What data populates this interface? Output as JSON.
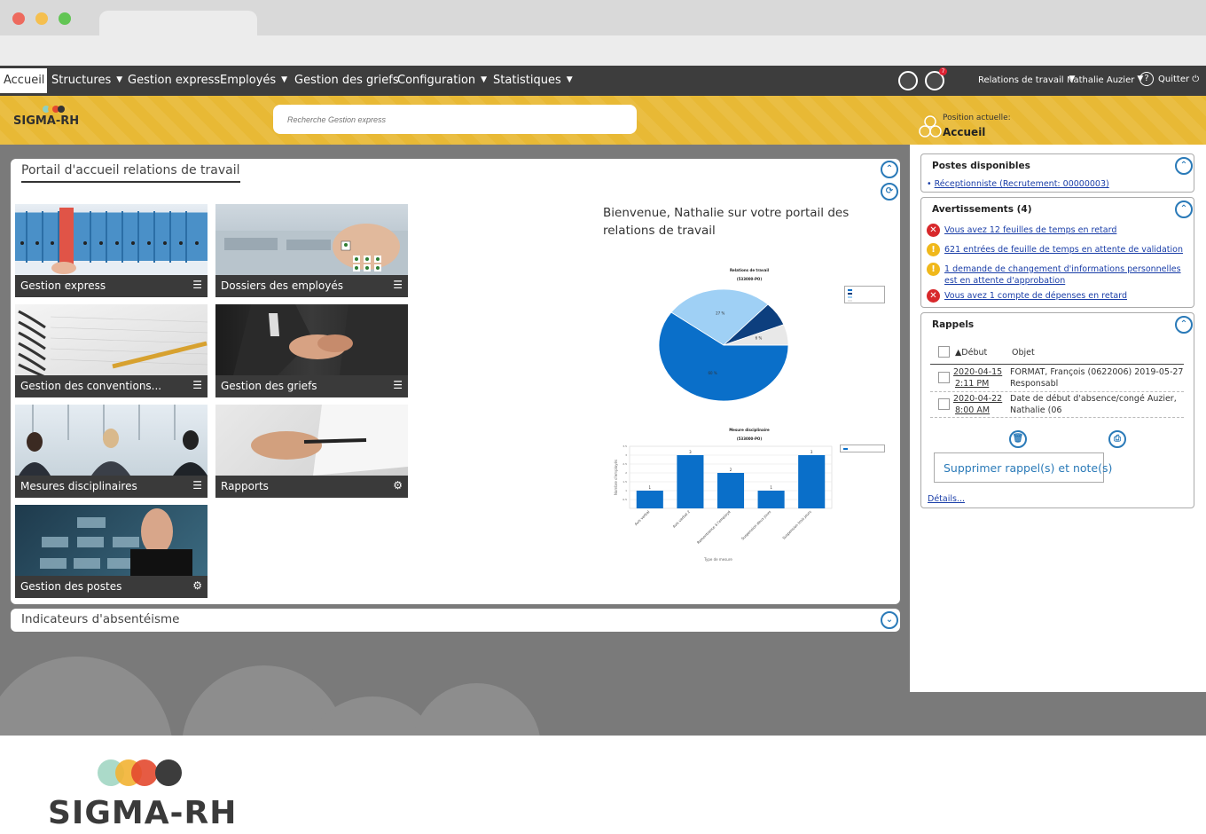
{
  "nav": {
    "items": [
      "Accueil",
      "Structures",
      "Gestion express",
      "Employés",
      "Gestion des griefs",
      "Configuration",
      "Statistiques"
    ],
    "notification_count": "7",
    "right_role": "Relations de travail",
    "right_user": "Nathalie Auzier",
    "help": "?",
    "quit": "Quitter"
  },
  "header": {
    "logo_text": "SIGMA-RH",
    "search_placeholder": "Recherche Gestion express",
    "position_label": "Position actuelle:",
    "position_value": "Accueil"
  },
  "portal": {
    "title": "Portail d'accueil relations de travail",
    "tiles": [
      {
        "label": "Gestion express",
        "icon": "list-icon"
      },
      {
        "label": "Dossiers des employés",
        "icon": "list-icon"
      },
      {
        "label": "Gestion des conventions...",
        "icon": "list-icon"
      },
      {
        "label": "Gestion des griefs",
        "icon": "list-icon"
      },
      {
        "label": "Mesures disciplinaires",
        "icon": "list-icon"
      },
      {
        "label": "Rapports",
        "icon": "gear-icon"
      },
      {
        "label": "Gestion des postes",
        "icon": "gear-icon"
      }
    ],
    "welcome": "Bienvenue,  Nathalie sur votre portail des relations de travail"
  },
  "chart_data": [
    {
      "type": "pie",
      "title": "Relations de travail",
      "subtitle": "(533000-PO)",
      "slices": [
        {
          "value": 60,
          "label": "60 %",
          "color": "#0a6fc9"
        },
        {
          "value": 27,
          "label": "27 %",
          "color": "#9fd0f5"
        },
        {
          "value": 7,
          "label": "",
          "color": "#0d3f7e"
        },
        {
          "value": 6,
          "label": "6 %",
          "color": "#e8e8e8"
        }
      ],
      "legend_position": "top-right"
    },
    {
      "type": "bar",
      "title": "Mesure disciplinaire",
      "subtitle": "(533000-PO)",
      "categories": [
        "Avis verbal",
        "Avis verbal 2",
        "Remontrance à l'employé",
        "Suspension deux jours",
        "Suspension trois jours"
      ],
      "values": [
        1,
        3,
        2,
        1,
        3
      ],
      "ylim": [
        0,
        3.5
      ],
      "xlabel": "Type de mesure",
      "ylabel": "Nombre d'employés",
      "bar_color": "#0a6fc9",
      "legend_position": "top-right"
    }
  ],
  "indicators": {
    "title": "Indicateurs d'absentéisme"
  },
  "postes": {
    "title": "Postes disponibles",
    "items": [
      "Réceptionniste (Recrutement: 00000003)"
    ]
  },
  "warnings": {
    "title": "Avertissements (4)",
    "items": [
      {
        "type": "error",
        "text": "Vous avez 12 feuilles de temps en retard"
      },
      {
        "type": "alert",
        "text": "621 entrées de feuille de temps en attente de validation"
      },
      {
        "type": "alert",
        "text": "1 demande de changement d'informations personnelles est en attente d'approbation"
      },
      {
        "type": "error",
        "text": "Vous avez 1 compte de dépenses en retard"
      }
    ]
  },
  "reminders": {
    "title": "Rappels",
    "col_start": "▲Début",
    "col_object": "Objet",
    "rows": [
      {
        "date": "2020-04-15",
        "time": "2:11 PM",
        "object": "FORMAT, François (0622006) 2019-05-27 Responsabl"
      },
      {
        "date": "2020-04-22",
        "time": "8:00 AM",
        "object": "Date de début d'absence/congé Auzier, Nathalie (06"
      }
    ],
    "delete_button": "Supprimer rappel(s) et note(s)",
    "details_link": "Détails..."
  },
  "footer": {
    "brand": "SIGMA-RH"
  }
}
